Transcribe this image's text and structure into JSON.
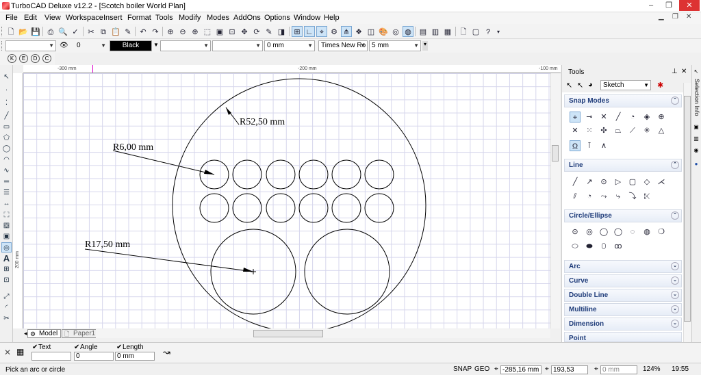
{
  "window": {
    "title": "TurboCAD Deluxe v12.2 - [Scotch boiler World Plan]",
    "min": "–",
    "max": "❐",
    "close": "✕"
  },
  "menu": [
    "File",
    "Edit",
    "View",
    "Workspace",
    "Insert",
    "Format",
    "Tools",
    "Modify",
    "Modes",
    "AddOns",
    "Options",
    "Window",
    "Help"
  ],
  "property_bar": {
    "layer_value": "0",
    "color_value": "Black",
    "thickness_value": "0 mm",
    "font_value": "Times New Ro",
    "font_size_value": "5 mm"
  },
  "rulers": {
    "top": [
      "-300 mm",
      "-200 mm",
      "-100 mm"
    ],
    "left": "200 mm"
  },
  "drawing": {
    "dim_outer": "R52,50 mm",
    "dim_small": "R6,00 mm",
    "dim_large": "R17,50 mm"
  },
  "tabs": {
    "model": "Model",
    "paper": "Paper1"
  },
  "tools_panel": {
    "title": "Tools",
    "mode": "Sketch",
    "sections": [
      "Snap Modes",
      "Line",
      "Circle/Ellipse",
      "Arc",
      "Curve",
      "Double Line",
      "Multiline",
      "Dimension",
      "Point"
    ]
  },
  "right_dock": {
    "selection_info": "Selection Info"
  },
  "inspector": {
    "text_label": "Text",
    "angle_label": "Angle",
    "angle_value": "0",
    "length_label": "Length",
    "length_value": "0 mm"
  },
  "status": {
    "message": "Pick an arc or circle",
    "snap": "SNAP",
    "geo": "GEO",
    "x": "-285,16 mm",
    "y": "193,53 mm",
    "z": "0 mm",
    "zoom": "124%",
    "time": "19:55"
  }
}
